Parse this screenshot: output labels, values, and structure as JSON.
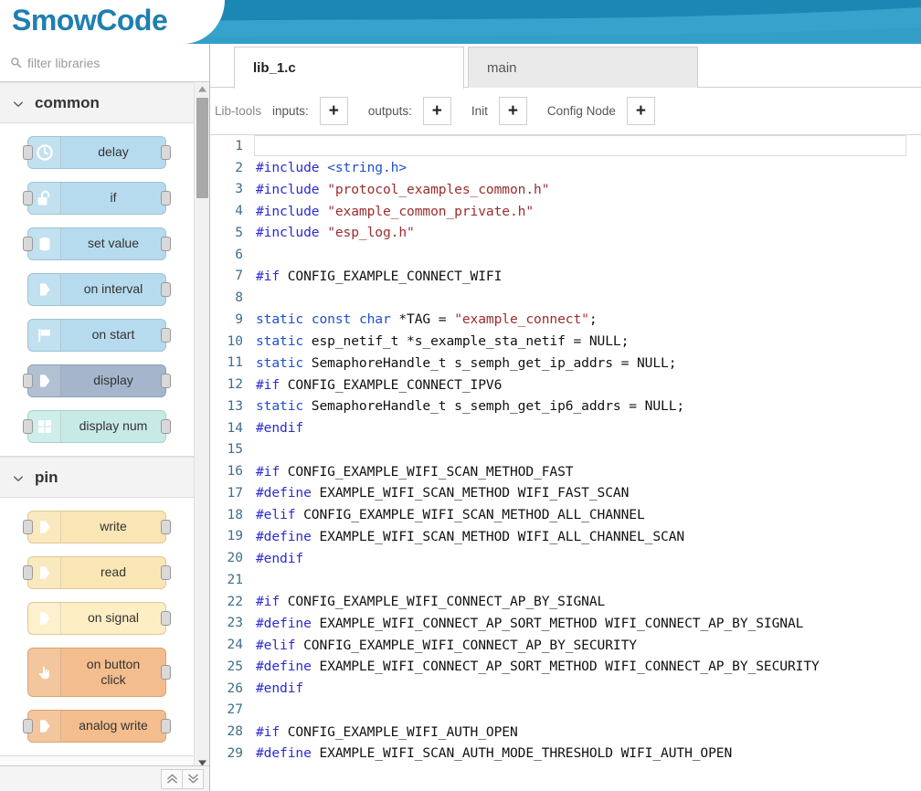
{
  "app": {
    "title": "SmowCode",
    "brand_color": "#1f7fb0",
    "banner_color": "#1b87b4",
    "banner_accent": "#35a3cc"
  },
  "sidebar": {
    "search": {
      "placeholder": "filter libraries",
      "value": "",
      "icon": "search-icon"
    },
    "categories": [
      {
        "label": "common",
        "expanded": true,
        "chevron": "chevron-down-icon",
        "nodes": [
          {
            "label": "delay",
            "icon": "clock-icon",
            "color": "c-blue",
            "port_left": true,
            "port_right": true
          },
          {
            "label": "if",
            "icon": "unlock-icon",
            "color": "c-blue",
            "port_left": true,
            "port_right": true
          },
          {
            "label": "set value",
            "icon": "database-icon",
            "color": "c-blue",
            "port_left": true,
            "port_right": true
          },
          {
            "label": "on interval",
            "icon": "arrow-icon",
            "color": "c-blue",
            "port_left": false,
            "port_right": true
          },
          {
            "label": "on start",
            "icon": "flag-icon",
            "color": "c-blue",
            "port_left": false,
            "port_right": true
          },
          {
            "label": "display",
            "icon": "arrow-icon",
            "color": "c-slate",
            "port_left": true,
            "port_right": true
          },
          {
            "label": "display num",
            "icon": "grid-icon",
            "color": "c-cyan",
            "port_left": true,
            "port_right": true
          }
        ]
      },
      {
        "label": "pin",
        "expanded": true,
        "chevron": "chevron-down-icon",
        "nodes": [
          {
            "label": "write",
            "icon": "arrow-icon",
            "color": "c-cream",
            "port_left": true,
            "port_right": true
          },
          {
            "label": "read",
            "icon": "arrow-icon",
            "color": "c-cream",
            "port_left": true,
            "port_right": true
          },
          {
            "label": "on signal",
            "icon": "arrow-icon",
            "color": "c-cream2",
            "port_left": false,
            "port_right": true
          },
          {
            "label": "on button\nclick",
            "icon": "hand-icon",
            "color": "c-orange",
            "port_left": false,
            "port_right": true,
            "tall": true
          },
          {
            "label": "analog write",
            "icon": "arrow-icon",
            "color": "c-orange",
            "port_left": true,
            "port_right": true
          }
        ]
      }
    ],
    "footer": {
      "collapse_all": "chevrons-up-icon",
      "expand_all": "chevrons-down-icon"
    }
  },
  "tabs": [
    {
      "label": "lib_1.c",
      "active": true
    },
    {
      "label": "main",
      "active": false
    }
  ],
  "libtools": {
    "title": "Lib-tools",
    "inputs_label": "inputs:",
    "inputs_add": "+",
    "outputs_label": "outputs:",
    "outputs_add": "+",
    "init_label": "Init",
    "init_add": "+",
    "config_label": "Config Node",
    "config_add": "+"
  },
  "editor": {
    "active_line": 1,
    "lines": [
      {
        "n": 1,
        "tokens": []
      },
      {
        "n": 2,
        "tokens": [
          {
            "t": "#include ",
            "c": "k-pp"
          },
          {
            "t": "<string.h>",
            "c": "k-kw"
          }
        ]
      },
      {
        "n": 3,
        "tokens": [
          {
            "t": "#include ",
            "c": "k-pp"
          },
          {
            "t": "\"protocol_examples_common.h\"",
            "c": "k-str"
          }
        ]
      },
      {
        "n": 4,
        "tokens": [
          {
            "t": "#include ",
            "c": "k-pp"
          },
          {
            "t": "\"example_common_private.h\"",
            "c": "k-str"
          }
        ]
      },
      {
        "n": 5,
        "tokens": [
          {
            "t": "#include ",
            "c": "k-pp"
          },
          {
            "t": "\"esp_log.h\"",
            "c": "k-str"
          }
        ]
      },
      {
        "n": 6,
        "tokens": []
      },
      {
        "n": 7,
        "tokens": [
          {
            "t": "#if ",
            "c": "k-pp"
          },
          {
            "t": "CONFIG_EXAMPLE_CONNECT_WIFI",
            "c": "k-pln"
          }
        ]
      },
      {
        "n": 8,
        "tokens": []
      },
      {
        "n": 9,
        "tokens": [
          {
            "t": "static",
            "c": "k-kw"
          },
          {
            "t": " ",
            "c": "k-pln"
          },
          {
            "t": "const",
            "c": "k-kw"
          },
          {
            "t": " ",
            "c": "k-pln"
          },
          {
            "t": "char",
            "c": "k-kw"
          },
          {
            "t": " *TAG = ",
            "c": "k-pln"
          },
          {
            "t": "\"example_connect\"",
            "c": "k-str"
          },
          {
            "t": ";",
            "c": "k-pln"
          }
        ]
      },
      {
        "n": 10,
        "tokens": [
          {
            "t": "static",
            "c": "k-kw"
          },
          {
            "t": " esp_netif_t *s_example_sta_netif = NULL;",
            "c": "k-pln"
          }
        ]
      },
      {
        "n": 11,
        "tokens": [
          {
            "t": "static",
            "c": "k-kw"
          },
          {
            "t": " SemaphoreHandle_t s_semph_get_ip_addrs = NULL;",
            "c": "k-pln"
          }
        ]
      },
      {
        "n": 12,
        "tokens": [
          {
            "t": "#if ",
            "c": "k-pp"
          },
          {
            "t": "CONFIG_EXAMPLE_CONNECT_IPV6",
            "c": "k-pln"
          }
        ]
      },
      {
        "n": 13,
        "tokens": [
          {
            "t": "static",
            "c": "k-kw"
          },
          {
            "t": " SemaphoreHandle_t s_semph_get_ip6_addrs = NULL;",
            "c": "k-pln"
          }
        ]
      },
      {
        "n": 14,
        "tokens": [
          {
            "t": "#endif",
            "c": "k-pp"
          }
        ]
      },
      {
        "n": 15,
        "tokens": []
      },
      {
        "n": 16,
        "tokens": [
          {
            "t": "#if ",
            "c": "k-pp"
          },
          {
            "t": "CONFIG_EXAMPLE_WIFI_SCAN_METHOD_FAST",
            "c": "k-pln"
          }
        ]
      },
      {
        "n": 17,
        "tokens": [
          {
            "t": "#define ",
            "c": "k-pp"
          },
          {
            "t": "EXAMPLE_WIFI_SCAN_METHOD WIFI_FAST_SCAN",
            "c": "k-pln"
          }
        ]
      },
      {
        "n": 18,
        "tokens": [
          {
            "t": "#elif ",
            "c": "k-pp"
          },
          {
            "t": "CONFIG_EXAMPLE_WIFI_SCAN_METHOD_ALL_CHANNEL",
            "c": "k-pln"
          }
        ]
      },
      {
        "n": 19,
        "tokens": [
          {
            "t": "#define ",
            "c": "k-pp"
          },
          {
            "t": "EXAMPLE_WIFI_SCAN_METHOD WIFI_ALL_CHANNEL_SCAN",
            "c": "k-pln"
          }
        ]
      },
      {
        "n": 20,
        "tokens": [
          {
            "t": "#endif",
            "c": "k-pp"
          }
        ]
      },
      {
        "n": 21,
        "tokens": []
      },
      {
        "n": 22,
        "tokens": [
          {
            "t": "#if ",
            "c": "k-pp"
          },
          {
            "t": "CONFIG_EXAMPLE_WIFI_CONNECT_AP_BY_SIGNAL",
            "c": "k-pln"
          }
        ]
      },
      {
        "n": 23,
        "tokens": [
          {
            "t": "#define ",
            "c": "k-pp"
          },
          {
            "t": "EXAMPLE_WIFI_CONNECT_AP_SORT_METHOD WIFI_CONNECT_AP_BY_SIGNAL",
            "c": "k-pln"
          }
        ]
      },
      {
        "n": 24,
        "tokens": [
          {
            "t": "#elif ",
            "c": "k-pp"
          },
          {
            "t": "CONFIG_EXAMPLE_WIFI_CONNECT_AP_BY_SECURITY",
            "c": "k-pln"
          }
        ]
      },
      {
        "n": 25,
        "tokens": [
          {
            "t": "#define ",
            "c": "k-pp"
          },
          {
            "t": "EXAMPLE_WIFI_CONNECT_AP_SORT_METHOD WIFI_CONNECT_AP_BY_SECURITY",
            "c": "k-pln"
          }
        ]
      },
      {
        "n": 26,
        "tokens": [
          {
            "t": "#endif",
            "c": "k-pp"
          }
        ]
      },
      {
        "n": 27,
        "tokens": []
      },
      {
        "n": 28,
        "tokens": [
          {
            "t": "#if ",
            "c": "k-pp"
          },
          {
            "t": "CONFIG_EXAMPLE_WIFI_AUTH_OPEN",
            "c": "k-pln"
          }
        ]
      },
      {
        "n": 29,
        "tokens": [
          {
            "t": "#define ",
            "c": "k-pp"
          },
          {
            "t": "EXAMPLE_WIFI_SCAN_AUTH_MODE_THRESHOLD WIFI_AUTH_OPEN",
            "c": "k-pln"
          }
        ]
      }
    ]
  }
}
